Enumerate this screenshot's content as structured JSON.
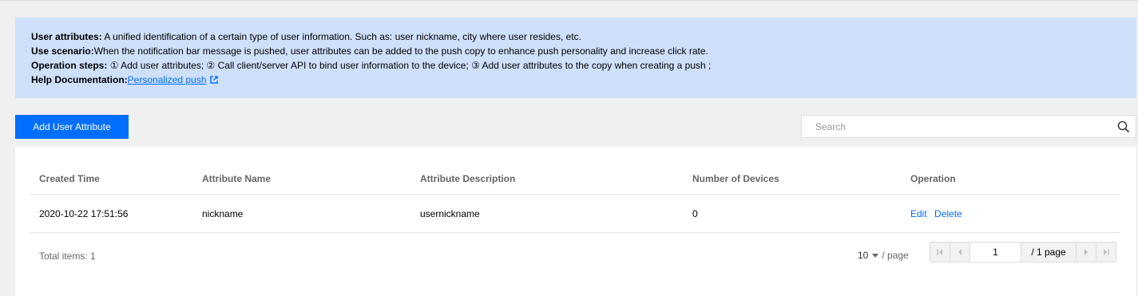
{
  "notice": {
    "attr_label": "User attributes:",
    "attr_text": " A unified identification of a certain type of user information. Such as: user nickname, city where user resides, etc.",
    "scenario_label": "Use scenario:",
    "scenario_text": "When the notification bar message is pushed, user attributes can be added to the push copy to enhance push personality and increase click rate.",
    "steps_label": "Operation steps:",
    "steps_text": " ① Add user attributes; ② Call client/server API to bind user information to the device; ③ Add user attributes to the copy when creating a push ;",
    "help_label": "Help Documentation:",
    "help_link": "Personalized push"
  },
  "toolbar": {
    "add_label": "Add User Attribute",
    "search_placeholder": "Search"
  },
  "table": {
    "headers": [
      "Created Time",
      "Attribute Name",
      "Attribute Description",
      "Number of Devices",
      "Operation"
    ],
    "rows": [
      {
        "created": "2020-10-22 17:51:56",
        "name": "nickname",
        "description": "usernickname",
        "devices": "0",
        "edit": "Edit",
        "delete": "Delete"
      }
    ]
  },
  "pagination": {
    "total": "Total items:  1",
    "page_size": "10",
    "page_size_suffix": "/ page",
    "current_page": "1",
    "total_pages": "/ 1 page"
  },
  "colors": {
    "accent": "#006eff",
    "notice_bg": "#cfe0fb"
  },
  "icons": [
    "external-link-icon",
    "search-icon",
    "first-page-icon",
    "prev-page-icon",
    "next-page-icon",
    "last-page-icon",
    "chevron-down-icon"
  ]
}
